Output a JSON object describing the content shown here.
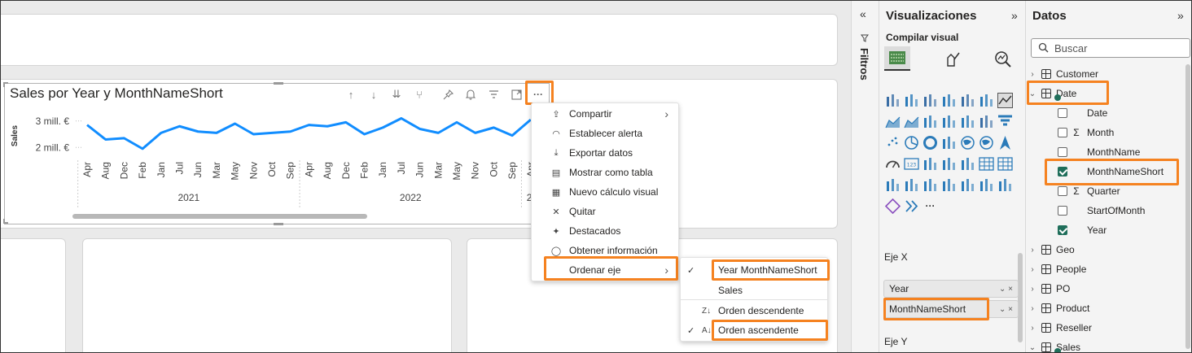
{
  "visual": {
    "title": "Sales por Year y MonthNameShort",
    "header_icons": [
      "arrow-up-icon",
      "arrow-down-icon",
      "double-arrow-down-icon",
      "fork-icon",
      "pin-icon",
      "bell-icon",
      "filter-icon",
      "focus-mode-icon",
      "more-options-icon"
    ],
    "more_label": "···"
  },
  "chart_data": {
    "type": "line",
    "ylabel": "Sales",
    "yticks": [
      "3 mill. €",
      "2 mill. €"
    ],
    "ylim": [
      1.7,
      3.3
    ],
    "x": [
      "Apr",
      "Aug",
      "Dec",
      "Feb",
      "Jan",
      "Jul",
      "Jun",
      "Mar",
      "May",
      "Nov",
      "Oct",
      "Sep",
      "Apr",
      "Aug",
      "Dec",
      "Feb",
      "Jan",
      "Jul",
      "Jun",
      "Mar",
      "May",
      "Nov",
      "Oct",
      "Sep",
      "Apr"
    ],
    "year_groups": [
      {
        "label": "2021",
        "from": 0,
        "to": 11
      },
      {
        "label": "2022",
        "from": 12,
        "to": 23
      },
      {
        "label": "2.",
        "from": 24,
        "to": 24
      }
    ],
    "series": [
      {
        "values": [
          2.85,
          2.3,
          2.35,
          1.95,
          2.55,
          2.8,
          2.6,
          2.55,
          2.9,
          2.5,
          2.55,
          2.6,
          2.85,
          2.8,
          2.95,
          2.5,
          2.75,
          3.1,
          2.7,
          2.55,
          2.95,
          2.55,
          2.75,
          2.45,
          3.05
        ],
        "color": "#118dff"
      }
    ]
  },
  "context_menu": {
    "items": [
      {
        "label": "Compartir",
        "icon": "share-icon",
        "submenu": true
      },
      {
        "label": "Establecer alerta",
        "icon": "bell-icon"
      },
      {
        "label": "Exportar datos",
        "icon": "export-icon"
      },
      {
        "label": "Mostrar como tabla",
        "icon": "table-view-icon"
      },
      {
        "label": "Nuevo cálculo visual",
        "icon": "calculator-icon"
      },
      {
        "label": "Quitar",
        "icon": "close-icon"
      },
      {
        "label": "Destacados",
        "icon": "spotlight-icon"
      },
      {
        "label": "Obtener información",
        "icon": "lightbulb-icon"
      },
      {
        "label": "Ordenar eje",
        "icon": "",
        "submenu": true
      }
    ]
  },
  "sort_submenu": {
    "items": [
      {
        "label": "Year MonthNameShort",
        "checked": true
      },
      {
        "label": "Sales",
        "checked": false
      },
      {
        "label": "Orden descendente",
        "icon": "sort-descending-icon",
        "checked": false
      },
      {
        "label": "Orden ascendente",
        "icon": "sort-ascending-icon",
        "checked": true
      }
    ]
  },
  "filters_pane": {
    "label": "Filtros",
    "collapse": "«"
  },
  "viz_pane": {
    "title": "Visualizaciones",
    "expand": "»",
    "build_label": "Compilar visual",
    "more_visuals": "···",
    "x_axis_label": "Eje X",
    "x_fields": [
      "Year",
      "MonthNameShort"
    ],
    "y_axis_label": "Eje Y",
    "field_controls": "⌄ ×"
  },
  "data_pane": {
    "title": "Datos",
    "expand": "»",
    "search_placeholder": "Buscar",
    "tables": [
      {
        "name": "Customer",
        "expanded": false
      },
      {
        "name": "Date",
        "expanded": true,
        "fields": [
          {
            "name": "Date",
            "sigma": false,
            "checked": false
          },
          {
            "name": "Month",
            "sigma": true,
            "checked": false
          },
          {
            "name": "MonthName",
            "sigma": false,
            "checked": false
          },
          {
            "name": "MonthNameShort",
            "sigma": false,
            "checked": true
          },
          {
            "name": "Quarter",
            "sigma": true,
            "checked": false
          },
          {
            "name": "StartOfMonth",
            "sigma": false,
            "checked": false
          },
          {
            "name": "Year",
            "sigma": false,
            "checked": true
          }
        ]
      },
      {
        "name": "Geo",
        "expanded": false
      },
      {
        "name": "People",
        "expanded": false
      },
      {
        "name": "PO",
        "expanded": false
      },
      {
        "name": "Product",
        "expanded": false
      },
      {
        "name": "Reseller",
        "expanded": false
      },
      {
        "name": "Sales",
        "expanded": true
      }
    ]
  },
  "colors": {
    "accent": "#f58220",
    "line": "#118dff",
    "check": "#1f6e5a"
  }
}
